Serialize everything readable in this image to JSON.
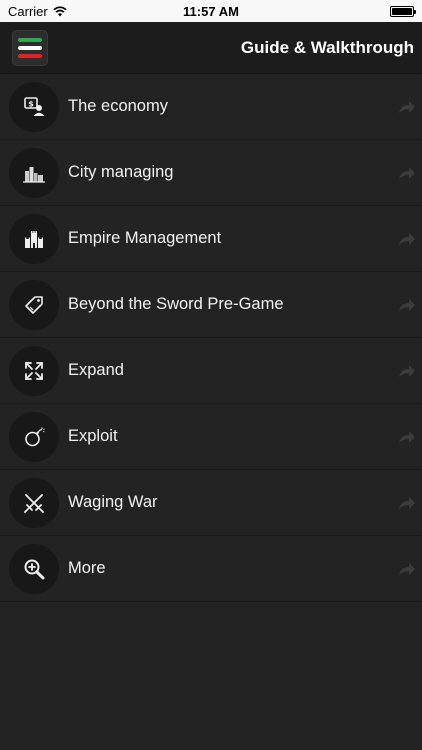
{
  "status_bar": {
    "carrier": "Carrier",
    "time": "11:57 AM"
  },
  "header": {
    "title": "Guide & Walkthrough",
    "menu_colors": [
      "#2fa84f",
      "#ffffff",
      "#e02424"
    ]
  },
  "menu_items": [
    {
      "label": "The economy",
      "icon": "money-person-icon"
    },
    {
      "label": "City managing",
      "icon": "city-icon"
    },
    {
      "label": "Empire Management",
      "icon": "castle-icon"
    },
    {
      "label": "Beyond the Sword Pre-Game",
      "icon": "sword-tag-icon"
    },
    {
      "label": "Expand",
      "icon": "expand-arrows-icon"
    },
    {
      "label": "Exploit",
      "icon": "bomb-icon"
    },
    {
      "label": "Waging War",
      "icon": "crossed-swords-icon"
    },
    {
      "label": "More",
      "icon": "zoom-in-icon"
    }
  ]
}
